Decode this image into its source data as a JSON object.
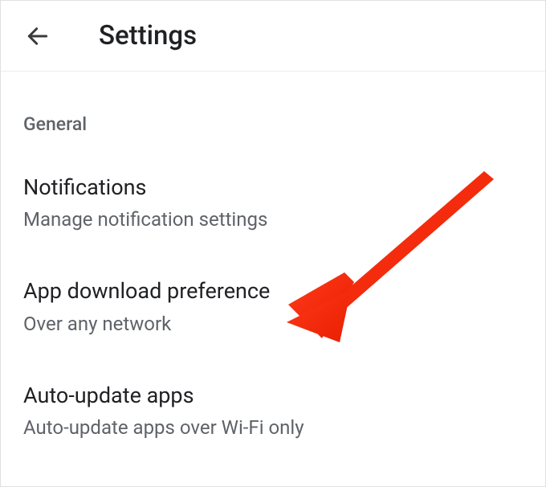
{
  "header": {
    "title": "Settings"
  },
  "section": {
    "label": "General"
  },
  "settings": [
    {
      "title": "Notifications",
      "subtitle": "Manage notification settings"
    },
    {
      "title": "App download preference",
      "subtitle": "Over any network"
    },
    {
      "title": "Auto-update apps",
      "subtitle": "Auto-update apps over Wi-Fi only"
    }
  ]
}
